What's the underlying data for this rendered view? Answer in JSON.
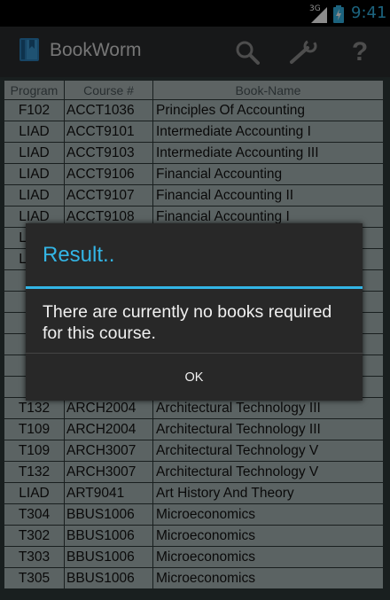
{
  "status_bar": {
    "network": "3G",
    "time": "9:41"
  },
  "action_bar": {
    "title": "BookWorm",
    "icons": [
      "app-icon",
      "search-icon",
      "wrench-icon",
      "help-icon"
    ],
    "help_glyph": "?"
  },
  "table": {
    "headers": [
      "Program",
      "Course #",
      "Book-Name"
    ],
    "rows": [
      [
        "F102",
        "ACCT1036",
        "Principles Of Accounting"
      ],
      [
        "LIAD",
        "ACCT9101",
        "Intermediate Accounting I"
      ],
      [
        "LIAD",
        "ACCT9103",
        "Intermediate Accounting III"
      ],
      [
        "LIAD",
        "ACCT9106",
        "Financial Accounting"
      ],
      [
        "LIAD",
        "ACCT9107",
        "Financial Accounting II"
      ],
      [
        "LIAD",
        "ACCT9108",
        "Financial Accounting I"
      ],
      [
        "LIAD",
        "",
        ""
      ],
      [
        "LIAD",
        "",
        ""
      ],
      [
        "T3",
        "",
        ""
      ],
      [
        "T",
        "",
        ""
      ],
      [
        "T",
        "",
        ""
      ],
      [
        "T",
        "",
        ""
      ],
      [
        "T",
        "",
        ""
      ],
      [
        "T",
        "",
        ""
      ],
      [
        "T132",
        "ARCH2004",
        "Architectural Technology III"
      ],
      [
        "T109",
        "ARCH2004",
        "Architectural Technology III"
      ],
      [
        "T109",
        "ARCH3007",
        "Architectural Technology V"
      ],
      [
        "T132",
        "ARCH3007",
        "Architectural Technology V"
      ],
      [
        "LIAD",
        "ART9041",
        "Art History And Theory"
      ],
      [
        "T304",
        "BBUS1006",
        "Microeconomics"
      ],
      [
        "T302",
        "BBUS1006",
        "Microeconomics"
      ],
      [
        "T303",
        "BBUS1006",
        "Microeconomics"
      ],
      [
        "T305",
        "BBUS1006",
        "Microeconomics"
      ]
    ]
  },
  "dialog": {
    "title": "Result..",
    "message": "There are currently no books required for this course.",
    "ok_label": "OK"
  },
  "colors": {
    "accent": "#33b5e5",
    "row_bg": "#a7b4b4",
    "header_bg": "#a9b5b5",
    "dialog_bg": "#282828",
    "action_bar_bg": "#2a2c2e"
  }
}
